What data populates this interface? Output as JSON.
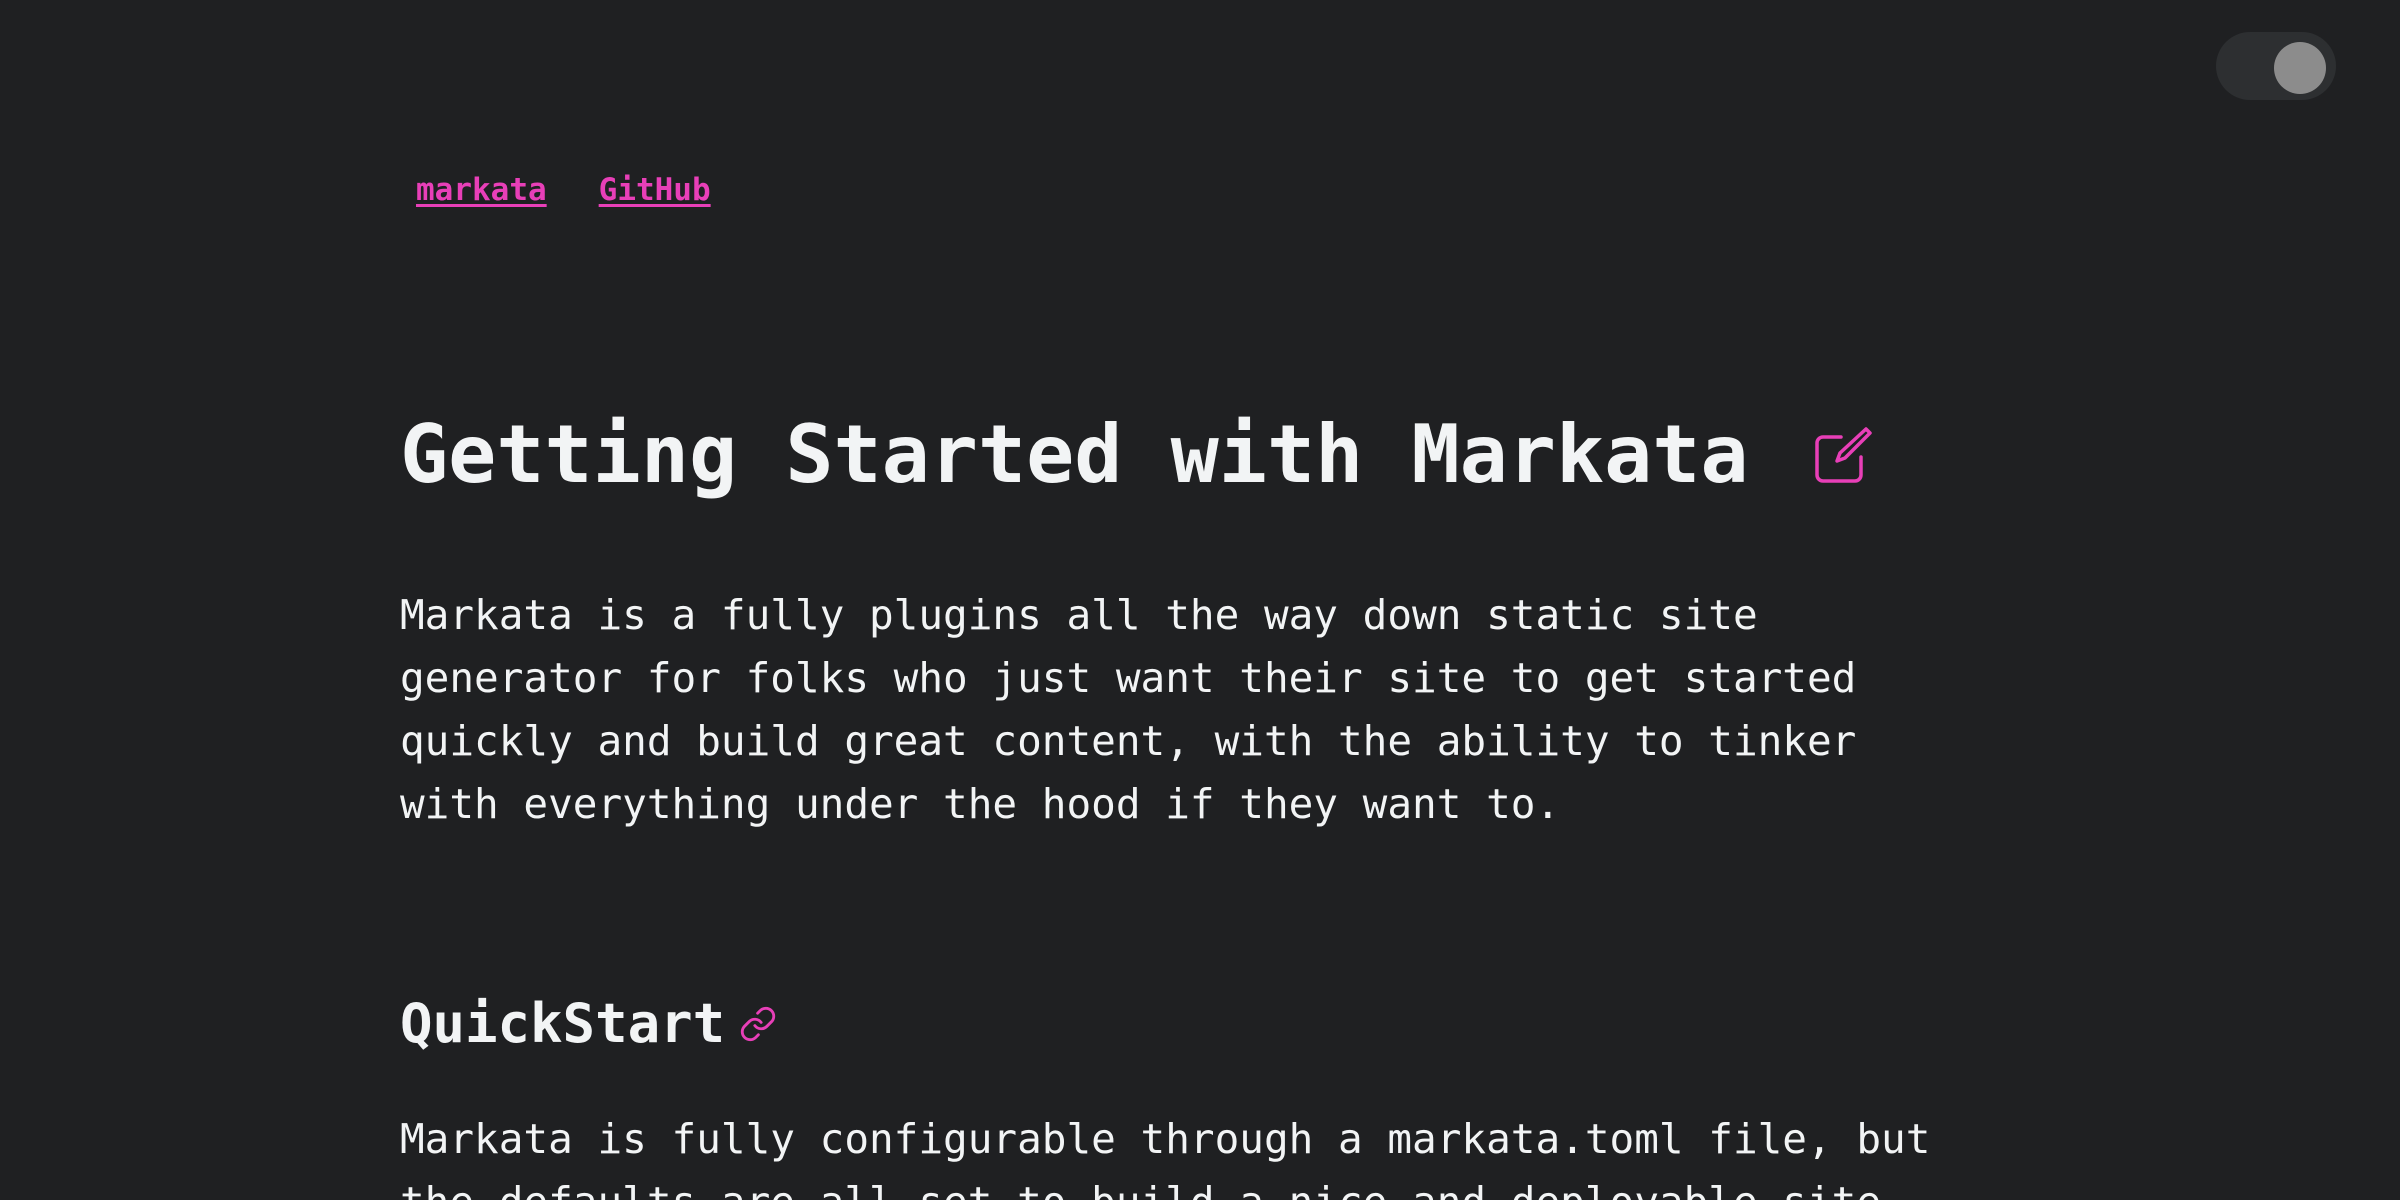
{
  "theme_toggle": {
    "state": "on"
  },
  "nav": {
    "items": [
      {
        "label": "markata"
      },
      {
        "label": "GitHub"
      }
    ]
  },
  "article": {
    "title": "Getting Started with Markata",
    "intro_lines": [
      "Markata is a fully plugins all the way down static site",
      "generator for folks who just want their site to get started",
      "quickly and build great content, with the ability to tinker",
      "with everything under the hood if they want to."
    ],
    "section_heading": "QuickStart",
    "section_lines": [
      "Markata is fully configurable through a markata.toml file, but",
      "the defaults are all set to build a nice and deployable site"
    ]
  },
  "colors": {
    "background": "#1f2022",
    "text": "#f2f4f5",
    "accent": "#e83fb8",
    "toggle_track": "#2d2f31",
    "toggle_knob": "#8c8c8c"
  },
  "icons": {
    "edit": "edit-icon",
    "anchor_link": "link-icon"
  }
}
